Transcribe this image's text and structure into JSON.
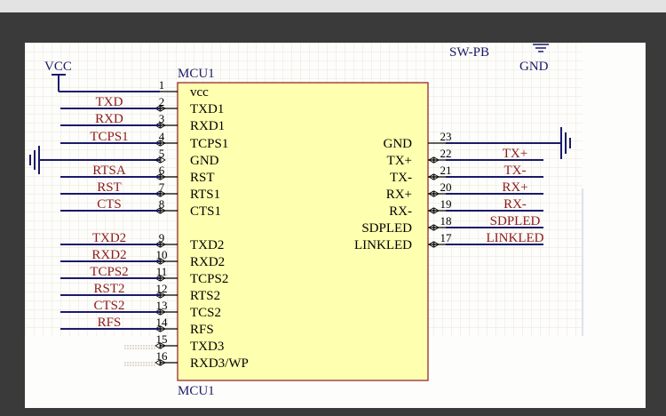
{
  "power": {
    "vcc_label": "VCC",
    "gnd_label": "GND"
  },
  "net_label_top": "SW-PB",
  "component": {
    "designator": "MCU1",
    "designator_bottom": "MCU1"
  },
  "left_pins": [
    {
      "num": "1",
      "name": "vcc",
      "net": ""
    },
    {
      "num": "2",
      "name": "TXD1",
      "net": "TXD"
    },
    {
      "num": "3",
      "name": "RXD1",
      "net": "RXD"
    },
    {
      "num": "4",
      "name": "TCPS1",
      "net": "TCPS1"
    },
    {
      "num": "5",
      "name": "GND",
      "net": ""
    },
    {
      "num": "6",
      "name": "RST",
      "net": "RTSA"
    },
    {
      "num": "7",
      "name": "RTS1",
      "net": "RST"
    },
    {
      "num": "8",
      "name": "CTS1",
      "net": "CTS"
    },
    {
      "num": "9",
      "name": "TXD2",
      "net": "TXD2"
    },
    {
      "num": "10",
      "name": "RXD2",
      "net": "RXD2"
    },
    {
      "num": "11",
      "name": "TCPS2",
      "net": "TCPS2"
    },
    {
      "num": "12",
      "name": "RTS2",
      "net": "RST2"
    },
    {
      "num": "13",
      "name": "TCS2",
      "net": "CTS2"
    },
    {
      "num": "14",
      "name": "RFS",
      "net": "RFS"
    },
    {
      "num": "15",
      "name": "TXD3",
      "net": ""
    },
    {
      "num": "16",
      "name": "RXD3/WP",
      "net": ""
    }
  ],
  "right_pins": [
    {
      "num": "23",
      "name": "GND",
      "net": ""
    },
    {
      "num": "22",
      "name": "TX+",
      "net": "TX+"
    },
    {
      "num": "21",
      "name": "TX-",
      "net": "TX-"
    },
    {
      "num": "20",
      "name": "RX+",
      "net": "RX+"
    },
    {
      "num": "19",
      "name": "RX-",
      "net": "RX-"
    },
    {
      "num": "18",
      "name": "SDPLED",
      "net": "SDPLED"
    },
    {
      "num": "17",
      "name": "LINKLED",
      "net": "LINKLED"
    }
  ],
  "colors": {
    "body_fill": "#ffffb0",
    "body_stroke": "#8b1a1a",
    "wire": "#1a1a6b",
    "net_text": "#8b1a1a",
    "grid": "#ebe5d8"
  }
}
